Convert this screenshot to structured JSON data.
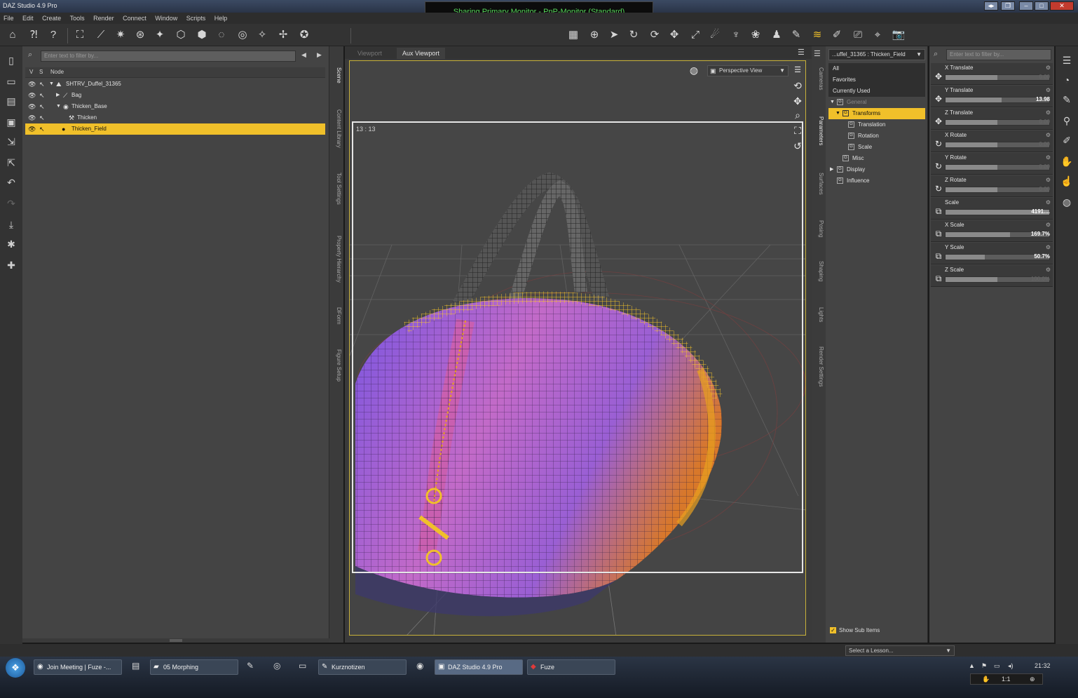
{
  "window": {
    "title": "DAZ Studio 4.9 Pro",
    "sharing_banner": "Sharing Primary Monitor - PnP-Monitor (Standard)"
  },
  "menu": [
    "File",
    "Edit",
    "Create",
    "Tools",
    "Render",
    "Connect",
    "Window",
    "Scripts",
    "Help"
  ],
  "scene": {
    "search_placeholder": "Enter text to filter by...",
    "col_v": "V",
    "col_s": "S",
    "col_node": "Node",
    "nodes": [
      {
        "label": "SHTRV_Duffel_31365",
        "icon": "figure-icon"
      },
      {
        "label": "Bag",
        "icon": "bone-icon"
      },
      {
        "label": "Thicken_Base",
        "icon": "modifier-icon"
      },
      {
        "label": "Thicken",
        "icon": "wrench-icon"
      },
      {
        "label": "Thicken_Field",
        "icon": "sphere-icon"
      }
    ]
  },
  "left_tabs": [
    "Scene",
    "Content Library",
    "Tool Settings",
    "Property Hierarchy",
    "DForm",
    "Figure Setup"
  ],
  "viewport": {
    "tabs": [
      "Viewport",
      "Aux Viewport"
    ],
    "view_label": "Perspective View",
    "aspect": "13 : 13"
  },
  "right_tabs": [
    "Cameras",
    "Parameters",
    "Surfaces",
    "Posing",
    "Shaping",
    "Lights",
    "Render Settings"
  ],
  "params": {
    "node_selector": "...uffel_31365 : Thicken_Field",
    "search_placeholder": "Enter text to filter by...",
    "categories": [
      {
        "label": "All"
      },
      {
        "label": "Favorites"
      },
      {
        "label": "Currently Used"
      },
      {
        "label": "General"
      },
      {
        "label": "Transforms"
      },
      {
        "label": "Translation"
      },
      {
        "label": "Rotation"
      },
      {
        "label": "Scale"
      },
      {
        "label": "Misc"
      },
      {
        "label": "Display"
      },
      {
        "label": "Influence"
      }
    ],
    "show_sub_items": "Show Sub Items",
    "sliders": [
      {
        "name": "X Translate",
        "value": "0.00",
        "icon": "move-icon",
        "fill": 0.5
      },
      {
        "name": "Y Translate",
        "value": "13.98",
        "icon": "move-icon",
        "fill": 0.54
      },
      {
        "name": "Z Translate",
        "value": "0.00",
        "icon": "move-icon",
        "fill": 0.5
      },
      {
        "name": "X Rotate",
        "value": "0.00",
        "icon": "rotate-icon",
        "fill": 0.5
      },
      {
        "name": "Y Rotate",
        "value": "0.00",
        "icon": "rotate-icon",
        "fill": 0.5
      },
      {
        "name": "Z Rotate",
        "value": "0.00",
        "icon": "rotate-icon",
        "fill": 0.5
      },
      {
        "name": "Scale",
        "value": "4191....",
        "icon": "scale-icon",
        "fill": 1.0
      },
      {
        "name": "X Scale",
        "value": "169.7%",
        "icon": "scale-icon",
        "fill": 0.62
      },
      {
        "name": "Y Scale",
        "value": "50.7%",
        "icon": "scale-icon",
        "fill": 0.38
      },
      {
        "name": "Z Scale",
        "value": "100.0%",
        "icon": "scale-icon",
        "fill": 0.5
      }
    ]
  },
  "lesson": {
    "placeholder": "Select a Lesson..."
  },
  "taskbar": {
    "items": [
      "Join Meeting | Fuze -...",
      "05 Morphing",
      "Kurznotizen",
      "DAZ Studio 4.9 Pro",
      "Fuze"
    ],
    "clock": "21:32",
    "zoom": "1:1"
  },
  "colors": {
    "selection": "#f0c02a",
    "share_text": "#56d65a",
    "mesh_purple": "#8a5ad8",
    "mesh_orange": "#e8a020"
  }
}
